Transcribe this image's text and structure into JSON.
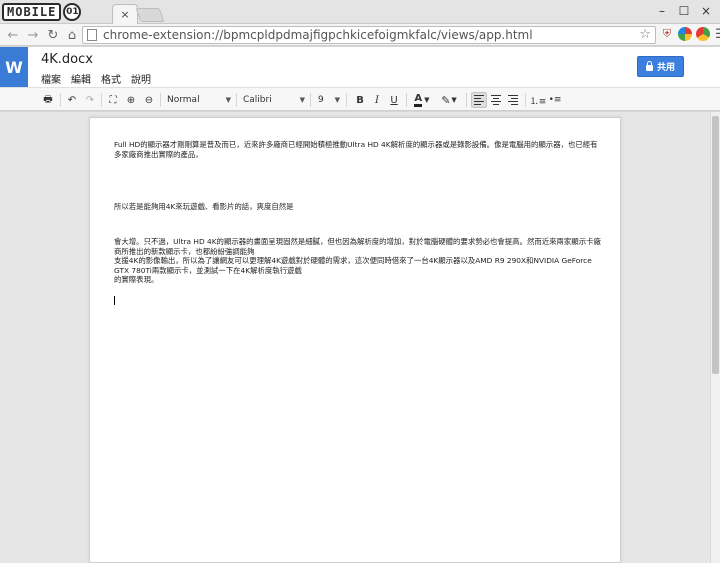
{
  "browser": {
    "logo_text": "MOBILE",
    "logo_badge": "01",
    "tab_close": "×",
    "url": "chrome-extension://bpmcpldpdmajfigpchkicefoigmkfalc/views/app.html",
    "window_controls": [
      "–",
      "☐",
      "×"
    ]
  },
  "app": {
    "logo_letter": "W",
    "doc_title": "4K.docx",
    "menu": [
      "檔案",
      "編輯",
      "格式",
      "說明"
    ],
    "share_label": "共用",
    "accent_color": "#3d7fde"
  },
  "format_toolbar": {
    "style": "Normal",
    "font": "Calibri",
    "size": "9",
    "bold": "B",
    "italic": "I",
    "underline": "U",
    "text_color": "A"
  },
  "document": {
    "paragraphs": [
      "Full HD的顯示器才剛剛算是普及而已，近來許多廠商已經開始積極推動Ultra HD 4K解析度的顯示器或是錄影設備。像是電腦用的顯示器，也已經有多家廠商推出實際的產品，",
      "所以若是能夠用4K來玩遊戲、看影片的話，爽度自然是",
      "會大增。只不過，Ultra HD 4K的顯示器的畫面呈現固然是細膩，但也因為解析度的增加，對於電腦硬體的要求勢必也會提高。然而近來兩家顯示卡廠商所推出的新款顯示卡，也都紛紛強調能夠",
      "支援4K的影像輸出，所以為了讓網友可以更理解4K遊戲對於硬體的需求，這次便同時借來了一台4K顯示器以及AMD R9 290X和NVIDIA GeForce GTX 780Ti兩款顯示卡，並測試一下在4K解析度執行遊戲",
      "的實際表現。"
    ]
  }
}
